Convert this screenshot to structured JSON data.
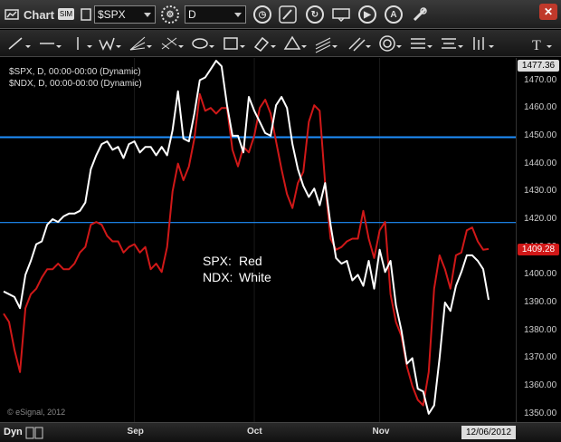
{
  "toolbar": {
    "title": "Chart",
    "badge": "SIM",
    "symbol": "$SPX",
    "interval": "D",
    "icons": [
      "link-icon",
      "symbol-search-icon",
      "interval-clock-icon",
      "pencil-icon",
      "refresh-icon",
      "get-icon",
      "play-icon",
      "alert-icon",
      "settings-icon",
      "close-icon"
    ]
  },
  "draw_tools": [
    "line-tool",
    "horizontal-line-tool",
    "vertical-line-tool",
    "zigzag-tool",
    "fan-tool",
    "fib-tool",
    "ellipse-tool",
    "rectangle-tool",
    "eraser-tool",
    "triangle-tool",
    "channel-tool",
    "parallel-lines-tool",
    "target-tool",
    "menu-tool",
    "list-tool",
    "bars-tool",
    "text-tool"
  ],
  "legend": {
    "line1": "$SPX, D, 00:00-00:00 (Dynamic)",
    "line2": "$NDX, D, 00:00-00:00 (Dynamic)"
  },
  "annotation": {
    "line1_label": "SPX:",
    "line1_value": "Red",
    "line2_label": "NDX:",
    "line2_value": "White"
  },
  "watermark": "© eSignal, 2012",
  "footer": {
    "dyn": "Dyn",
    "date": "12/06/2012"
  },
  "colors": {
    "spx": "#d01818",
    "ndx": "#ffffff",
    "hline": "#1e90ff",
    "top_tag": "#ffffff",
    "price_tag": "#d01818"
  },
  "chart_data": {
    "type": "line",
    "y_ticks": [
      "1470.00",
      "1460.00",
      "1450.00",
      "1440.00",
      "1430.00",
      "1420.00",
      "1410.00",
      "1400.00",
      "1390.00",
      "1380.00",
      "1370.00",
      "1360.00",
      "1350.00"
    ],
    "y_tick_values": [
      1470,
      1460,
      1450,
      1440,
      1430,
      1420,
      1410,
      1400,
      1390,
      1380,
      1370,
      1360,
      1350
    ],
    "ylim": [
      1347,
      1478
    ],
    "x_ticks": [
      "Sep",
      "Oct",
      "Nov"
    ],
    "x_tick_index": [
      24,
      46,
      69
    ],
    "price_tags": [
      {
        "label": "1477.36",
        "value": 1477.36,
        "style": "top"
      },
      {
        "label": "1409.28",
        "value": 1409.28,
        "style": "spx"
      }
    ],
    "horizontal_lines": [
      1449.5,
      1418.8
    ],
    "series": [
      {
        "values": [
          1386,
          1383,
          1373,
          1365,
          1388,
          1393,
          1395,
          1399,
          1402,
          1402,
          1404,
          1402,
          1402,
          1404,
          1408,
          1410,
          1418,
          1419,
          1418,
          1414,
          1412,
          1412,
          1408,
          1410,
          1411,
          1408,
          1410,
          1402,
          1404,
          1401,
          1410,
          1430,
          1440,
          1434,
          1439,
          1449,
          1465,
          1459,
          1460,
          1458,
          1460,
          1460,
          1445,
          1439,
          1446,
          1444,
          1450,
          1460,
          1463,
          1458,
          1448,
          1438,
          1429,
          1424,
          1433,
          1437,
          1455,
          1461,
          1459,
          1433,
          1413,
          1409,
          1410,
          1412,
          1413,
          1413,
          1423,
          1413,
          1406,
          1416,
          1419,
          1393,
          1383,
          1378,
          1367,
          1360,
          1355,
          1353,
          1365,
          1395,
          1407,
          1402,
          1395,
          1407,
          1408,
          1416,
          1417,
          1412,
          1409,
          1409.28
        ]
      },
      {
        "values": [
          1394,
          1393,
          1392,
          1388,
          1400,
          1405,
          1411,
          1412,
          1418,
          1420,
          1419,
          1421,
          1422,
          1422,
          1423,
          1426,
          1438,
          1443,
          1447,
          1448,
          1445,
          1446,
          1442,
          1447,
          1448,
          1444,
          1446,
          1446,
          1443,
          1446,
          1443,
          1452,
          1466,
          1449,
          1448,
          1458,
          1470,
          1471,
          1474,
          1477,
          1475,
          1461,
          1450,
          1450,
          1444,
          1464,
          1459,
          1455,
          1451,
          1450,
          1461,
          1464,
          1460,
          1447,
          1438,
          1432,
          1428,
          1431,
          1425,
          1433,
          1418,
          1406,
          1404,
          1405,
          1398,
          1400,
          1396,
          1405,
          1395,
          1409,
          1401,
          1405,
          1389,
          1380,
          1368,
          1370,
          1359,
          1358,
          1350,
          1353,
          1370,
          1390,
          1387,
          1396,
          1401,
          1407,
          1407,
          1405,
          1402,
          1391
        ]
      }
    ]
  }
}
